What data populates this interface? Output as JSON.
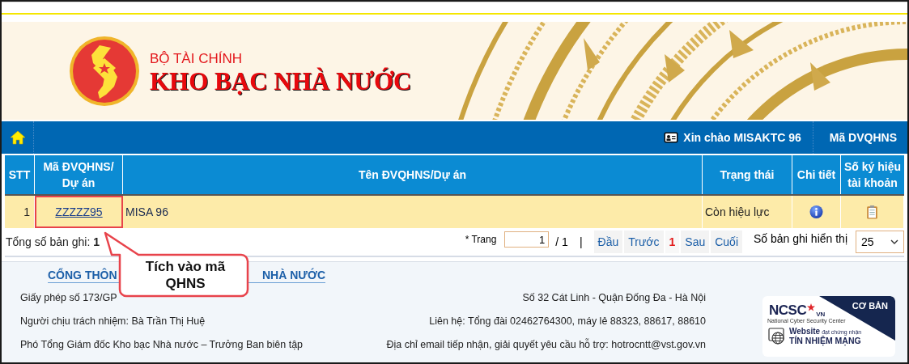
{
  "banner": {
    "ministry": "BỘ TÀI CHÍNH",
    "title": "KHO BẠC NHÀ NƯỚC"
  },
  "navbar": {
    "greeting": "Xin chào MISAKTC 96",
    "link": "Mã DVQHNS"
  },
  "table": {
    "columns": [
      {
        "kind": "stt",
        "label": "STT"
      },
      {
        "kind": "code",
        "label": "Mã ĐVQHNS/ Dự án"
      },
      {
        "kind": "name",
        "label": "Tên ĐVQHNS/Dự án"
      },
      {
        "kind": "status",
        "label": "Trạng thái"
      },
      {
        "kind": "detail",
        "label": "Chi tiết"
      },
      {
        "kind": "account",
        "label": "Số ký hiệu tài khoản"
      }
    ],
    "rows": [
      {
        "stt": "1",
        "code": "ZZZZZ95",
        "name": "MISA 96",
        "status": "Còn hiệu lực",
        "highlighted": true
      }
    ]
  },
  "pager": {
    "total": "Tổng số bản ghi: **1**",
    "page_label": "* Trang",
    "page_value": "1",
    "page_count": "/ 1",
    "separator": "|",
    "buttons": [
      {
        "label": "Đầu",
        "selected": false
      },
      {
        "label": "Trước",
        "selected": false
      },
      {
        "label": "1",
        "selected": true
      },
      {
        "label": "Sau",
        "selected": false
      },
      {
        "label": "Cuối",
        "selected": false
      }
    ],
    "page_size_label": "Số bản ghi hiển thị",
    "page_size": "25"
  },
  "callout": {
    "text": "Tích vào mã QHNS"
  },
  "footer": {
    "heading_parts": [
      "CỔNG THÔN",
      "NHÀ NƯỚC"
    ],
    "left_lines": [
      "Giấy phép số 173/GP",
      "Người chịu trách nhiệm: Bà Trần Thị Huệ",
      "Phó Tổng Giám đốc Kho bạc Nhà nước – Trưởng Ban biên tập"
    ],
    "right_lines": [
      "Số 32 Cát Linh - Quận Đống Đa - Hà Nội",
      "Liên hệ: Tổng đài 02462764300, máy lẻ 88323, 88617, 88610",
      "Địa chỉ email tiếp nhận, giải quyết yêu cầu hỗ trợ: hotrocntt@vst.gov.vn"
    ],
    "badge": {
      "level": "CƠ BẢN",
      "logo": "NCSC",
      "logo_suffix": "VN",
      "logo_caption": "National Cyber Security Center",
      "website": "Website",
      "certified": "đạt chứng nhận",
      "trust": "TÍN NHIỆM MẠNG"
    }
  }
}
